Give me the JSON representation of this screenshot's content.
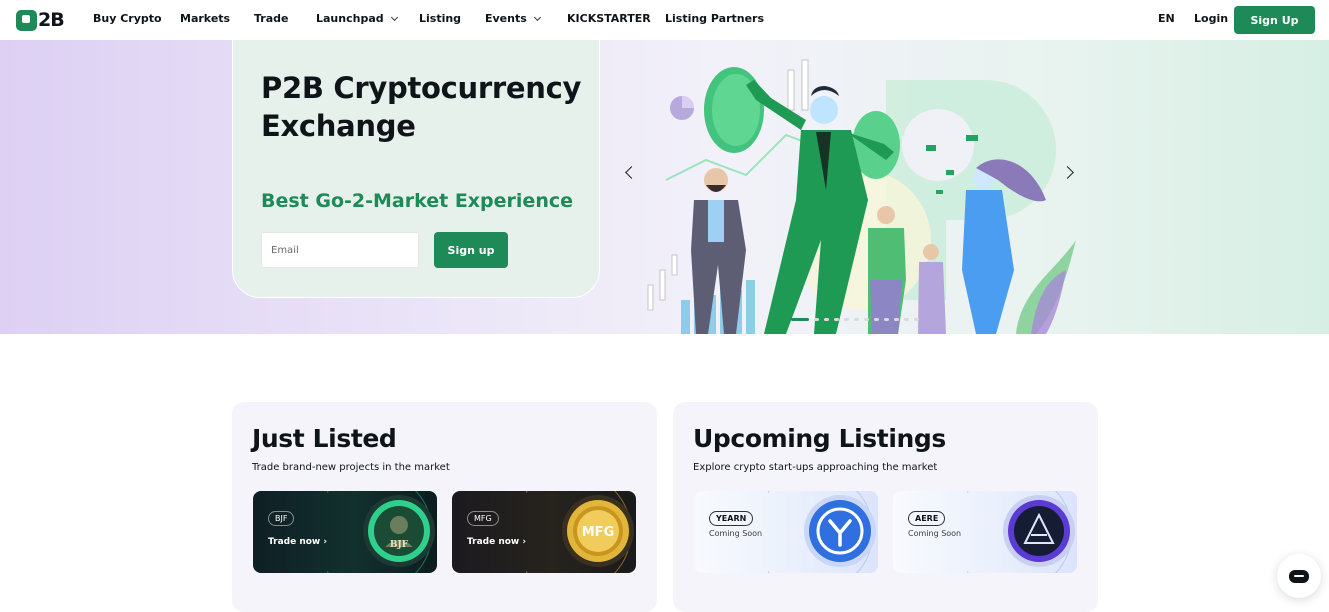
{
  "nav": {
    "logo_text": "2B",
    "items": [
      {
        "label": "Buy Crypto"
      },
      {
        "label": "Markets"
      },
      {
        "label": "Trade"
      },
      {
        "label": "Launchpad"
      },
      {
        "label": "Listing"
      },
      {
        "label": "Events"
      },
      {
        "label": "KICKSTARTER"
      },
      {
        "label": "Listing Partners"
      }
    ],
    "language": "EN",
    "login": "Login",
    "signup": "Sign Up"
  },
  "hero": {
    "title": "P2B Cryptocurrency Exchange",
    "subtitle": "Best Go-2-Market Experience",
    "email_placeholder": "Email",
    "signup": "Sign up",
    "carousel": {
      "slide_count": 12,
      "active_index": 1
    }
  },
  "just_listed": {
    "title": "Just Listed",
    "description": "Trade brand-new projects in the market",
    "cards": [
      {
        "ticker": "BJF",
        "action": "Trade now",
        "coin_text": "BJF"
      },
      {
        "ticker": "MFG",
        "action": "Trade now",
        "coin_text": "MFG"
      }
    ]
  },
  "upcoming": {
    "title": "Upcoming Listings",
    "description": "Explore crypto start-ups approaching the market",
    "cards": [
      {
        "ticker": "YEARN",
        "status": "Coming Soon"
      },
      {
        "ticker": "AERE",
        "status": "Coming Soon"
      }
    ]
  },
  "colors": {
    "brand_green": "#1e8a57",
    "text_dark": "#0f1419",
    "panel_bg": "#f4f4fa"
  },
  "icons": [
    "logo-mark-icon",
    "chevron-down-icon",
    "arrow-left-icon",
    "arrow-right-icon",
    "chevron-right-icon",
    "chat-icon"
  ]
}
